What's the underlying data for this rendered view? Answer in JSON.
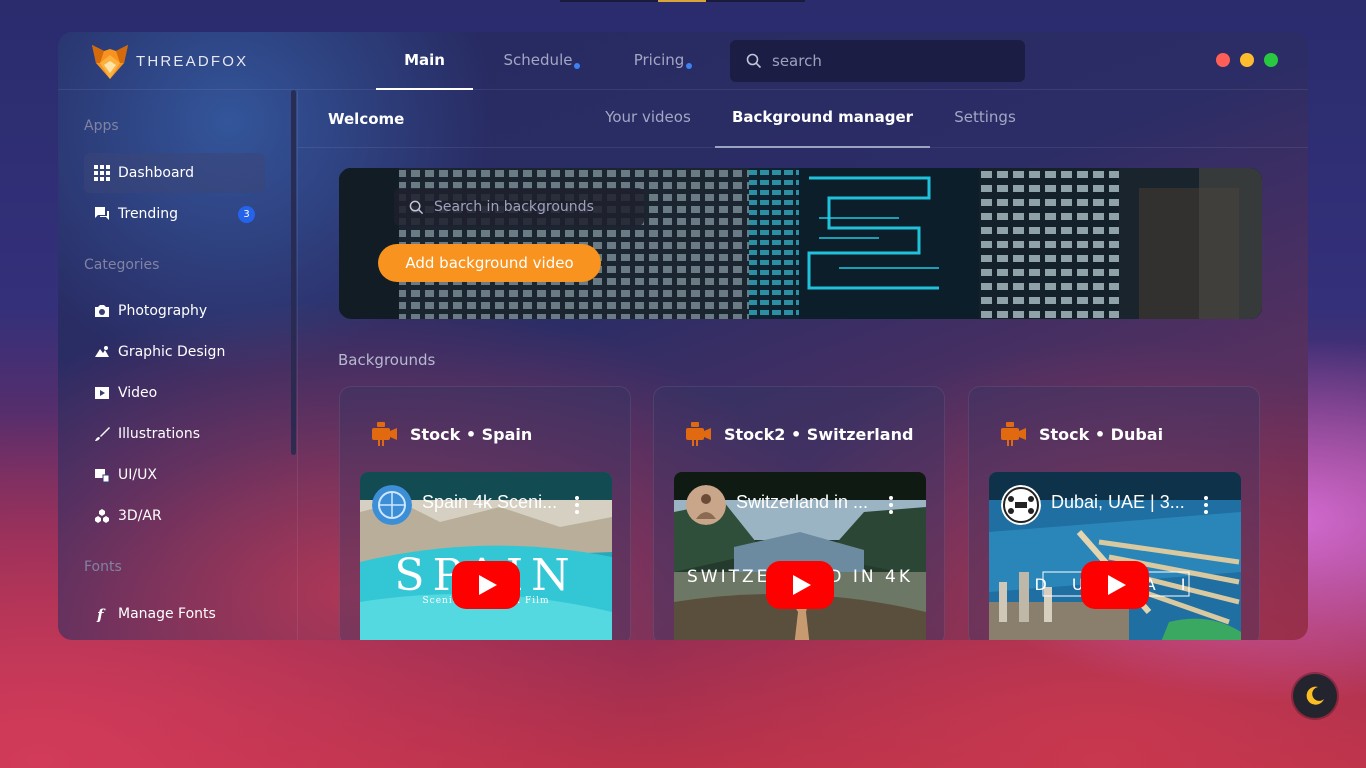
{
  "app": {
    "name": "THREADFOX"
  },
  "header": {
    "nav": [
      {
        "label": "Main",
        "active": true,
        "dot": false
      },
      {
        "label": "Schedule",
        "active": false,
        "dot": true
      },
      {
        "label": "Pricing",
        "active": false,
        "dot": true
      }
    ],
    "search_placeholder": "search",
    "traffic_lights": [
      "#ff5f57",
      "#febc2e",
      "#28c840"
    ]
  },
  "sidebar": {
    "sections": [
      {
        "label": "Apps"
      },
      {
        "label": "Categories"
      },
      {
        "label": "Fonts"
      }
    ],
    "apps": [
      {
        "label": "Dashboard",
        "icon": "grid-icon",
        "active": true
      },
      {
        "label": "Trending",
        "icon": "chat-icon",
        "badge": "3"
      }
    ],
    "categories": [
      {
        "label": "Photography",
        "icon": "camera-icon"
      },
      {
        "label": "Graphic Design",
        "icon": "design-icon"
      },
      {
        "label": "Video",
        "icon": "film-icon"
      },
      {
        "label": "Illustrations",
        "icon": "brush-icon"
      },
      {
        "label": "UI/UX",
        "icon": "layout-icon"
      },
      {
        "label": "3D/AR",
        "icon": "cubes-icon"
      }
    ],
    "fonts": [
      {
        "label": "Manage Fonts",
        "icon": "font-icon"
      }
    ]
  },
  "subnav": {
    "welcome": "Welcome",
    "tabs": [
      {
        "label": "Your videos",
        "active": false
      },
      {
        "label": "Background manager",
        "active": true
      },
      {
        "label": "Settings",
        "active": false
      }
    ]
  },
  "banner": {
    "search_placeholder": "Search in backgrounds",
    "add_button": "Add background video"
  },
  "backgrounds": {
    "label": "Backgrounds",
    "cards": [
      {
        "title": "Stock • Spain",
        "video_title": "Spain 4k Sceni...",
        "overlay": "SPAIN",
        "overlay_sub": "Scenic Relaxation Film"
      },
      {
        "title": "Stock2 • Switzerland",
        "video_title": "Switzerland in ...",
        "overlay": "SWITZERLAND IN 4K"
      },
      {
        "title": "Stock • Dubai",
        "video_title": "Dubai, UAE | 3...",
        "overlay": "D U B A I"
      }
    ]
  },
  "colors": {
    "accent": "#f7931e",
    "badge": "#2563eb",
    "play": "#ff0000"
  }
}
